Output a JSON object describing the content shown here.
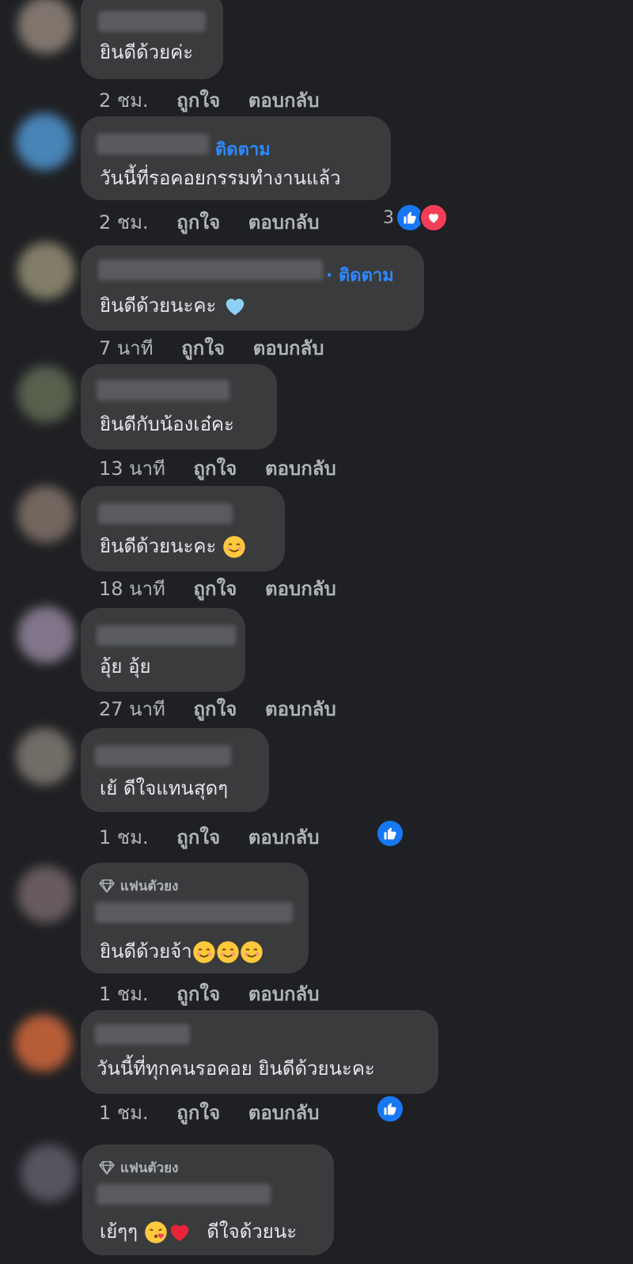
{
  "comments": [
    {
      "text": "ยินดีด้วยค่ะ",
      "time": "2 ชม.",
      "like": "ถูกใจ",
      "reply": "ตอบกลับ",
      "avatar_color": "#8a7f76"
    },
    {
      "follow": "ติดตาม",
      "text": "วันนี้ที่รอคอยกรรมทำงานแล้ว",
      "time": "2 ชม.",
      "like": "ถูกใจ",
      "reply": "ตอบกลับ",
      "reaction_count": "3",
      "avatar_color": "#4d8fc7"
    },
    {
      "follow": "· ติดตาม",
      "text": "ยินดีด้วยนะคะ",
      "time": "7 นาที",
      "like": "ถูกใจ",
      "reply": "ตอบกลับ",
      "avatar_color": "#8d8770"
    },
    {
      "text": "ยินดีกับน้องเอ๋คะ",
      "time": "13 นาที",
      "like": "ถูกใจ",
      "reply": "ตอบกลับ",
      "avatar_color": "#5e6652"
    },
    {
      "text": "ยินดีด้วยนะคะ",
      "time": "18 นาที",
      "like": "ถูกใจ",
      "reply": "ตอบกลับ",
      "avatar_color": "#7c6e66"
    },
    {
      "text": "อุ้ย อุ้ย",
      "time": "27 นาที",
      "like": "ถูกใจ",
      "reply": "ตอบกลับ",
      "avatar_color": "#8c7f95"
    },
    {
      "text": "เย้ ดีใจแทนสุดๆ",
      "time": "1 ชม.",
      "like": "ถูกใจ",
      "reply": "ตอบกลับ",
      "avatar_color": "#7b756f"
    },
    {
      "badge": "แฟนตัวยง",
      "text": "ยินดีด้วยจ้า",
      "time": "1 ชม.",
      "like": "ถูกใจ",
      "reply": "ตอบกลับ",
      "avatar_color": "#6f6266"
    },
    {
      "text": "วันนี้ที่ทุกคนรอคอย ยินดีด้วยนะคะ",
      "time": "1 ชม.",
      "like": "ถูกใจ",
      "reply": "ตอบกลับ",
      "avatar_color": "#c7643b"
    },
    {
      "badge": "แฟนตัวยง",
      "text": "เย้ๆๆ",
      "text2": "ดีใจด้วยนะ",
      "avatar_color": "#5c5a66"
    }
  ],
  "colors": {
    "link": "#2d88ff",
    "like": "#1877f2",
    "love": "#f33e58",
    "bubble": "#3a3b3c"
  }
}
